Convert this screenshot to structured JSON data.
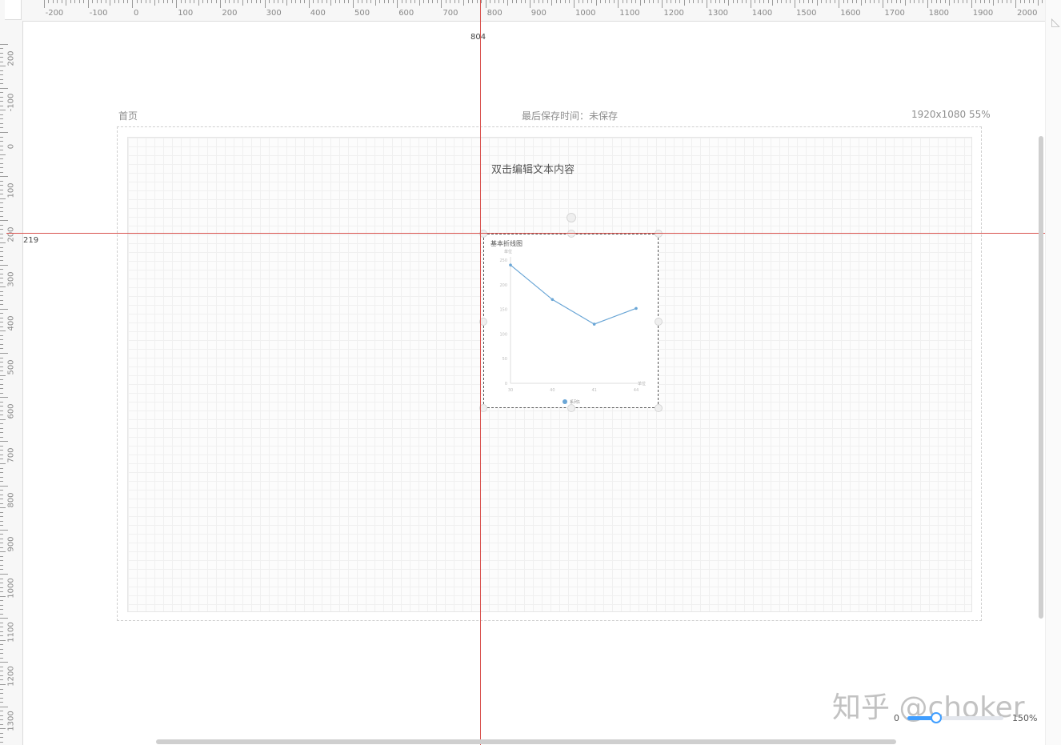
{
  "ruler": {
    "top_labels": [
      "-200",
      "-100",
      "0",
      "100",
      "200",
      "300",
      "400",
      "500",
      "600",
      "700",
      "800",
      "900",
      "1000",
      "1100",
      "1200",
      "1300",
      "1400",
      "1500",
      "1600",
      "1700",
      "1800",
      "1900",
      "2000"
    ],
    "left_labels": [
      "200",
      "-100",
      "0",
      "100",
      "200",
      "300",
      "400",
      "500",
      "600",
      "700",
      "800",
      "900",
      "1000",
      "1100",
      "1200",
      "1300"
    ]
  },
  "guides": {
    "vertical_label": "804",
    "horizontal_label": "219"
  },
  "header": {
    "page_name": "首页",
    "save_status": "最后保存时间：未保存",
    "canvas_info": "1920x1080 55%"
  },
  "components": {
    "text_placeholder": "双击编辑文本内容"
  },
  "chart_data": {
    "type": "line",
    "title": "基本折线图",
    "ylabel": "单位",
    "xlabel": "单位",
    "categories": [
      "30",
      "40",
      "41",
      "44"
    ],
    "series": [
      {
        "name": "系列1",
        "values": [
          240,
          170,
          120,
          152
        ]
      }
    ],
    "ylim": [
      0,
      250
    ],
    "yticks": [
      "0",
      "50",
      "100",
      "150",
      "200",
      "250"
    ],
    "grid": false,
    "legend": "bottom",
    "color": "#6aa6d6"
  },
  "zoom": {
    "min_label": "0",
    "max_label": "150%",
    "value": 0.3
  },
  "watermark": "知乎 @choker",
  "colors": {
    "guide": "#d9534f",
    "accent": "#409eff"
  }
}
